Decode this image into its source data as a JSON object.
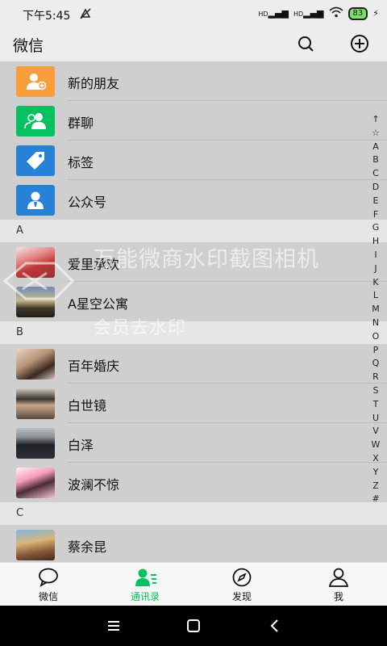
{
  "status": {
    "time": "下午5:45",
    "battery": "83",
    "sig1": "HD",
    "sig2": "HD"
  },
  "header": {
    "title": "微信"
  },
  "fixed_items": [
    {
      "label": "新的朋友",
      "icon": "add-friend-icon",
      "color": "#fa9d3b"
    },
    {
      "label": "群聊",
      "icon": "group-chat-icon",
      "color": "#07c160"
    },
    {
      "label": "标签",
      "icon": "tag-icon",
      "color": "#2782d7"
    },
    {
      "label": "公众号",
      "icon": "official-account-icon",
      "color": "#2782d7"
    }
  ],
  "sections": [
    {
      "letter": "A",
      "contacts": [
        {
          "name": "爱里承欢"
        },
        {
          "name": "A星空公寓"
        }
      ]
    },
    {
      "letter": "B",
      "contacts": [
        {
          "name": "百年婚庆"
        },
        {
          "name": "白世镜"
        },
        {
          "name": "白泽"
        },
        {
          "name": "波澜不惊"
        }
      ]
    },
    {
      "letter": "C",
      "contacts": [
        {
          "name": "蔡余昆"
        }
      ]
    }
  ],
  "index_letters": [
    "↑",
    "☆",
    "A",
    "B",
    "C",
    "D",
    "E",
    "F",
    "G",
    "H",
    "I",
    "J",
    "K",
    "L",
    "M",
    "N",
    "O",
    "P",
    "Q",
    "R",
    "S",
    "T",
    "U",
    "V",
    "W",
    "X",
    "Y",
    "Z",
    "#"
  ],
  "watermark": {
    "line1": "万能微商水印截图相机",
    "line2": "会员去水印"
  },
  "tabs": [
    {
      "label": "微信",
      "icon": "chat-icon"
    },
    {
      "label": "通讯录",
      "icon": "contacts-icon",
      "active": true
    },
    {
      "label": "发现",
      "icon": "discover-icon"
    },
    {
      "label": "我",
      "icon": "me-icon"
    }
  ],
  "colors": {
    "accent": "#07c160",
    "header_bg": "#ededed",
    "list_bg": "#cfcfcf"
  }
}
